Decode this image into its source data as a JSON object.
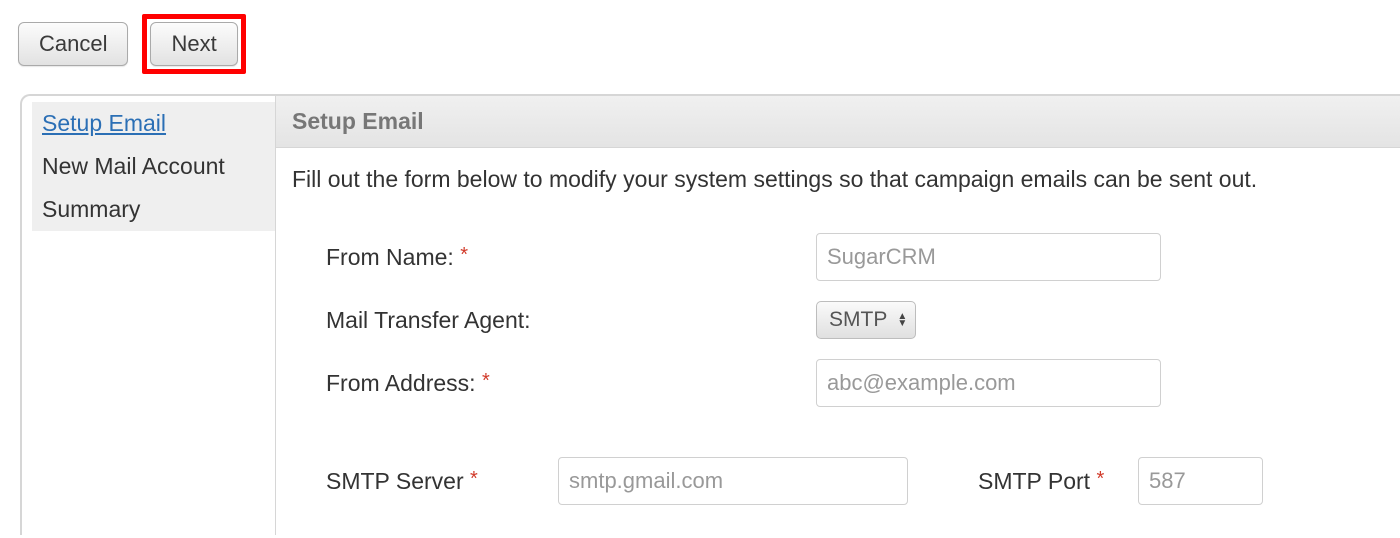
{
  "toolbar": {
    "cancel_label": "Cancel",
    "next_label": "Next"
  },
  "sidebar": {
    "items": [
      {
        "label": "Setup Email",
        "active": true
      },
      {
        "label": "New Mail Account",
        "active": false
      },
      {
        "label": "Summary",
        "active": false
      }
    ]
  },
  "panel": {
    "title": "Setup Email",
    "description": "Fill out the form below to modify your system settings so that campaign emails can be sent out."
  },
  "form": {
    "from_name": {
      "label": "From Name:",
      "required": true,
      "value": "SugarCRM"
    },
    "mta": {
      "label": "Mail Transfer Agent:",
      "required": false,
      "value": "SMTP"
    },
    "from_address": {
      "label": "From Address:",
      "required": true,
      "value": "abc@example.com"
    },
    "smtp_server": {
      "label": "SMTP Server",
      "required": true,
      "value": "smtp.gmail.com"
    },
    "smtp_port": {
      "label": "SMTP Port",
      "required": true,
      "value": "587"
    }
  },
  "required_marker": "*"
}
